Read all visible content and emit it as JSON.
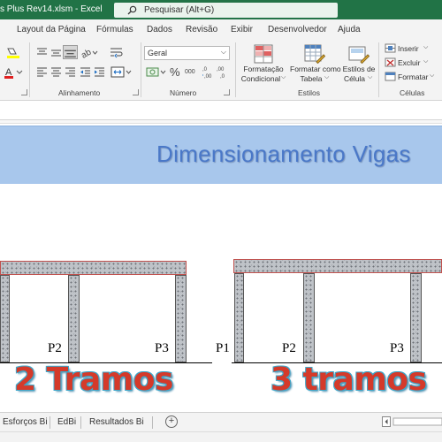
{
  "window": {
    "doc_title": "s Plus Rev14.xlsm  -  Excel",
    "search_placeholder": "Pesquisar (Alt+G)"
  },
  "ribbon_tabs": [
    "Layout da Página",
    "Fórmulas",
    "Dados",
    "Revisão",
    "Exibir",
    "Desenvolvedor",
    "Ajuda"
  ],
  "ribbon": {
    "groups": {
      "alignment": "Alinhamento",
      "number": "Número",
      "styles": "Estilos",
      "cells": "Células"
    },
    "number_format": "Geral",
    "styles_buttons": {
      "conditional": [
        "Formatação",
        "Condicional"
      ],
      "table": [
        "Formatar como",
        "Tabela"
      ],
      "cell_styles": [
        "Estilos de",
        "Célula"
      ]
    },
    "cells_buttons": [
      "Inserir",
      "Excluir",
      "Formatar"
    ]
  },
  "banner": {
    "title": "Dimensionamento Vigas"
  },
  "drawing": {
    "left_labels": [
      "P2",
      "P3"
    ],
    "right_labels": [
      "P1",
      "P2",
      "P3"
    ],
    "left_caption": "2 Tramos",
    "right_caption": "3 tramos",
    "beam_border_color": "#c0504d",
    "caption_color": "#d43a2a"
  },
  "sheet_tabs": [
    "Esforços Bi",
    "EdBi",
    "Resultados Bi"
  ],
  "colors": {
    "excel_green": "#217346",
    "banner_bg": "#a8c7ec",
    "banner_text": "#4a78c8"
  }
}
